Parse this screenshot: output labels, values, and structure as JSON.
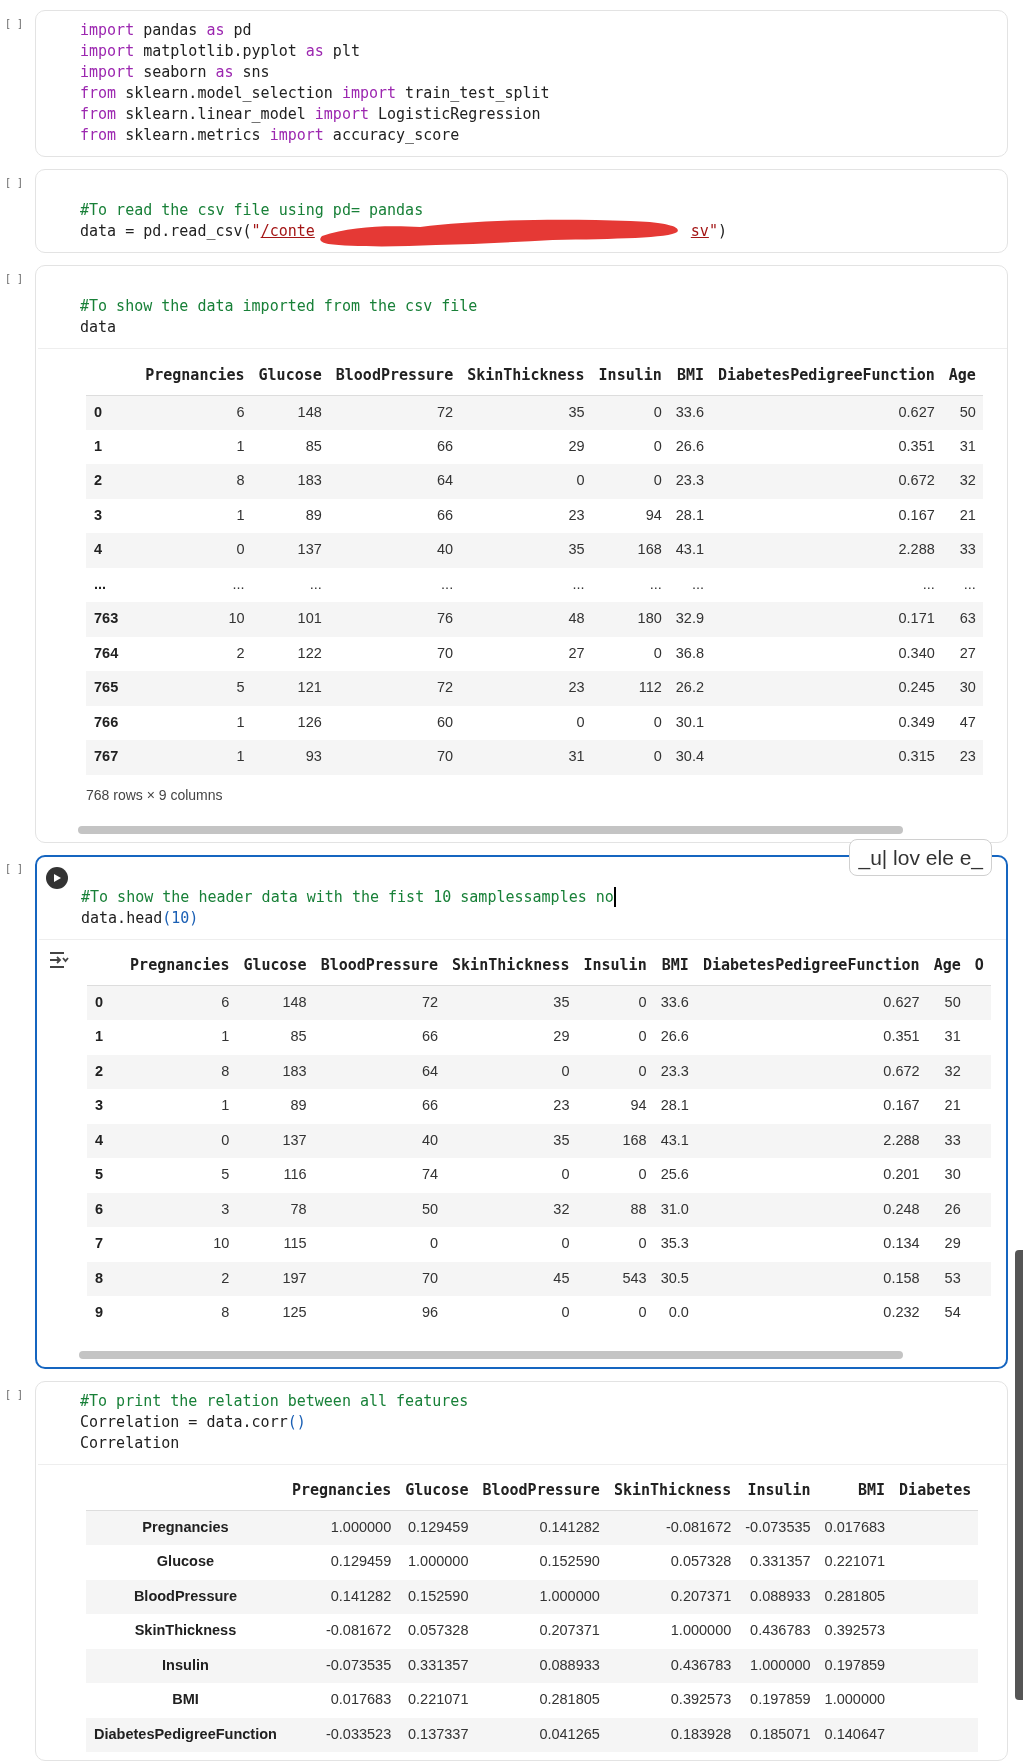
{
  "cells": [
    {
      "bracket": "[ ]",
      "active": false,
      "run_button": false,
      "leading_blank": false,
      "cursor": false,
      "lines": [
        [
          {
            "text": "import",
            "kind": "keyword"
          },
          {
            "text": " pandas ",
            "kind": "plain"
          },
          {
            "text": "as",
            "kind": "keyword"
          },
          {
            "text": " pd",
            "kind": "plain"
          }
        ],
        [
          {
            "text": "import",
            "kind": "keyword"
          },
          {
            "text": " matplotlib.pyplot ",
            "kind": "plain"
          },
          {
            "text": "as",
            "kind": "keyword"
          },
          {
            "text": " plt",
            "kind": "plain"
          }
        ],
        [
          {
            "text": "import",
            "kind": "keyword"
          },
          {
            "text": " seaborn ",
            "kind": "plain"
          },
          {
            "text": "as",
            "kind": "keyword"
          },
          {
            "text": " sns",
            "kind": "plain"
          }
        ],
        [
          {
            "text": "from",
            "kind": "keyword"
          },
          {
            "text": " sklearn.model_selection ",
            "kind": "plain"
          },
          {
            "text": "import",
            "kind": "keyword"
          },
          {
            "text": " train_test_split",
            "kind": "plain"
          }
        ],
        [
          {
            "text": "from",
            "kind": "keyword"
          },
          {
            "text": " sklearn.linear_model ",
            "kind": "plain"
          },
          {
            "text": "import",
            "kind": "keyword"
          },
          {
            "text": " LogisticRegression",
            "kind": "plain"
          }
        ],
        [
          {
            "text": "from",
            "kind": "keyword"
          },
          {
            "text": " sklearn.metrics ",
            "kind": "plain"
          },
          {
            "text": "import",
            "kind": "keyword"
          },
          {
            "text": " accuracy_score",
            "kind": "plain"
          }
        ]
      ]
    },
    {
      "bracket": "[ ]",
      "active": false,
      "run_button": false,
      "leading_blank": true,
      "cursor": false,
      "lines": [
        [
          {
            "text": "#To read the csv file using pd= pandas",
            "kind": "comment"
          }
        ],
        [
          {
            "text": "data = pd.read_csv(",
            "kind": "plain"
          },
          {
            "text": "\"",
            "kind": "string"
          },
          {
            "text": "/conte",
            "kind": "path"
          },
          {
            "kind": "redacted"
          },
          {
            "text": "sv",
            "kind": "path"
          },
          {
            "text": "\"",
            "kind": "string"
          },
          {
            "text": ")",
            "kind": "plain"
          }
        ]
      ]
    },
    {
      "bracket": "[ ]",
      "active": false,
      "run_button": false,
      "leading_blank": true,
      "cursor": false,
      "lines": [
        [
          {
            "text": "#To show the data imported from the csv file",
            "kind": "comment"
          }
        ],
        [
          {
            "text": "data",
            "kind": "plain"
          }
        ]
      ],
      "output": {
        "kind": "dataframe",
        "output_toggle": false,
        "h_scrollbar": true,
        "footer": "768 rows × 9 columns",
        "columns": [
          "Pregnancies",
          "Glucose",
          "BloodPressure",
          "SkinThickness",
          "Insulin",
          "BMI",
          "DiabetesPedigreeFunction",
          "Age"
        ],
        "rows": [
          {
            "index": "0",
            "values": [
              "6",
              "148",
              "72",
              "35",
              "0",
              "33.6",
              "0.627",
              "50"
            ]
          },
          {
            "index": "1",
            "values": [
              "1",
              "85",
              "66",
              "29",
              "0",
              "26.6",
              "0.351",
              "31"
            ]
          },
          {
            "index": "2",
            "values": [
              "8",
              "183",
              "64",
              "0",
              "0",
              "23.3",
              "0.672",
              "32"
            ]
          },
          {
            "index": "3",
            "values": [
              "1",
              "89",
              "66",
              "23",
              "94",
              "28.1",
              "0.167",
              "21"
            ]
          },
          {
            "index": "4",
            "values": [
              "0",
              "137",
              "40",
              "35",
              "168",
              "43.1",
              "2.288",
              "33"
            ]
          },
          {
            "index": "...",
            "values": [
              "...",
              "...",
              "...",
              "...",
              "...",
              "...",
              "...",
              "..."
            ]
          },
          {
            "index": "763",
            "values": [
              "10",
              "101",
              "76",
              "48",
              "180",
              "32.9",
              "0.171",
              "63"
            ]
          },
          {
            "index": "764",
            "values": [
              "2",
              "122",
              "70",
              "27",
              "0",
              "36.8",
              "0.340",
              "27"
            ]
          },
          {
            "index": "765",
            "values": [
              "5",
              "121",
              "72",
              "23",
              "112",
              "26.2",
              "0.245",
              "30"
            ]
          },
          {
            "index": "766",
            "values": [
              "1",
              "126",
              "60",
              "0",
              "0",
              "30.1",
              "0.349",
              "47"
            ]
          },
          {
            "index": "767",
            "values": [
              "1",
              "93",
              "70",
              "31",
              "0",
              "30.4",
              "0.315",
              "23"
            ]
          }
        ]
      }
    },
    {
      "bracket": "[ ]",
      "active": true,
      "run_button": true,
      "cursor": true,
      "toolbar": "_u| lov ele e_",
      "lines": [
        [
          {
            "text": "#To show the header data with the fist 10 samplessamples no",
            "kind": "comment"
          }
        ],
        [
          {
            "text": "data.head",
            "kind": "plain"
          },
          {
            "text": "(10)",
            "kind": "punct"
          }
        ]
      ],
      "output": {
        "kind": "dataframe",
        "output_toggle": true,
        "h_scrollbar": true,
        "columns": [
          "Pregnancies",
          "Glucose",
          "BloodPressure",
          "SkinThickness",
          "Insulin",
          "BMI",
          "DiabetesPedigreeFunction",
          "Age",
          "O"
        ],
        "rows": [
          {
            "index": "0",
            "values": [
              "6",
              "148",
              "72",
              "35",
              "0",
              "33.6",
              "0.627",
              "50"
            ]
          },
          {
            "index": "1",
            "values": [
              "1",
              "85",
              "66",
              "29",
              "0",
              "26.6",
              "0.351",
              "31"
            ]
          },
          {
            "index": "2",
            "values": [
              "8",
              "183",
              "64",
              "0",
              "0",
              "23.3",
              "0.672",
              "32"
            ]
          },
          {
            "index": "3",
            "values": [
              "1",
              "89",
              "66",
              "23",
              "94",
              "28.1",
              "0.167",
              "21"
            ]
          },
          {
            "index": "4",
            "values": [
              "0",
              "137",
              "40",
              "35",
              "168",
              "43.1",
              "2.288",
              "33"
            ]
          },
          {
            "index": "5",
            "values": [
              "5",
              "116",
              "74",
              "0",
              "0",
              "25.6",
              "0.201",
              "30"
            ]
          },
          {
            "index": "6",
            "values": [
              "3",
              "78",
              "50",
              "32",
              "88",
              "31.0",
              "0.248",
              "26"
            ]
          },
          {
            "index": "7",
            "values": [
              "10",
              "115",
              "0",
              "0",
              "0",
              "35.3",
              "0.134",
              "29"
            ]
          },
          {
            "index": "8",
            "values": [
              "2",
              "197",
              "70",
              "45",
              "543",
              "30.5",
              "0.158",
              "53"
            ]
          },
          {
            "index": "9",
            "values": [
              "8",
              "125",
              "96",
              "0",
              "0",
              "0.0",
              "0.232",
              "54"
            ]
          }
        ]
      }
    },
    {
      "bracket": "[ ]",
      "active": false,
      "run_button": false,
      "leading_blank": false,
      "cursor": false,
      "lines": [
        [
          {
            "text": "#To print the relation between all features",
            "kind": "comment"
          }
        ],
        [
          {
            "text": "Correlation = data.corr",
            "kind": "plain"
          },
          {
            "text": "()",
            "kind": "punct"
          }
        ],
        [
          {
            "text": "Correlation",
            "kind": "plain"
          }
        ]
      ],
      "output": {
        "kind": "matrix",
        "output_toggle": false,
        "h_scrollbar": false,
        "columns": [
          "Pregnancies",
          "Glucose",
          "BloodPressure",
          "SkinThickness",
          "Insulin",
          "BMI",
          "Diabetes"
        ],
        "rows": [
          {
            "index": "Pregnancies",
            "values": [
              "1.000000",
              "0.129459",
              "0.141282",
              "-0.081672",
              "-0.073535",
              "0.017683"
            ]
          },
          {
            "index": "Glucose",
            "values": [
              "0.129459",
              "1.000000",
              "0.152590",
              "0.057328",
              "0.331357",
              "0.221071"
            ]
          },
          {
            "index": "BloodPressure",
            "values": [
              "0.141282",
              "0.152590",
              "1.000000",
              "0.207371",
              "0.088933",
              "0.281805"
            ]
          },
          {
            "index": "SkinThickness",
            "values": [
              "-0.081672",
              "0.057328",
              "0.207371",
              "1.000000",
              "0.436783",
              "0.392573"
            ]
          },
          {
            "index": "Insulin",
            "values": [
              "-0.073535",
              "0.331357",
              "0.088933",
              "0.436783",
              "1.000000",
              "0.197859"
            ]
          },
          {
            "index": "BMI",
            "values": [
              "0.017683",
              "0.221071",
              "0.281805",
              "0.392573",
              "0.197859",
              "1.000000"
            ]
          },
          {
            "index": "DiabetesPedigreeFunction",
            "values": [
              "-0.033523",
              "0.137337",
              "0.041265",
              "0.183928",
              "0.185071",
              "0.140647"
            ]
          }
        ]
      }
    }
  ]
}
